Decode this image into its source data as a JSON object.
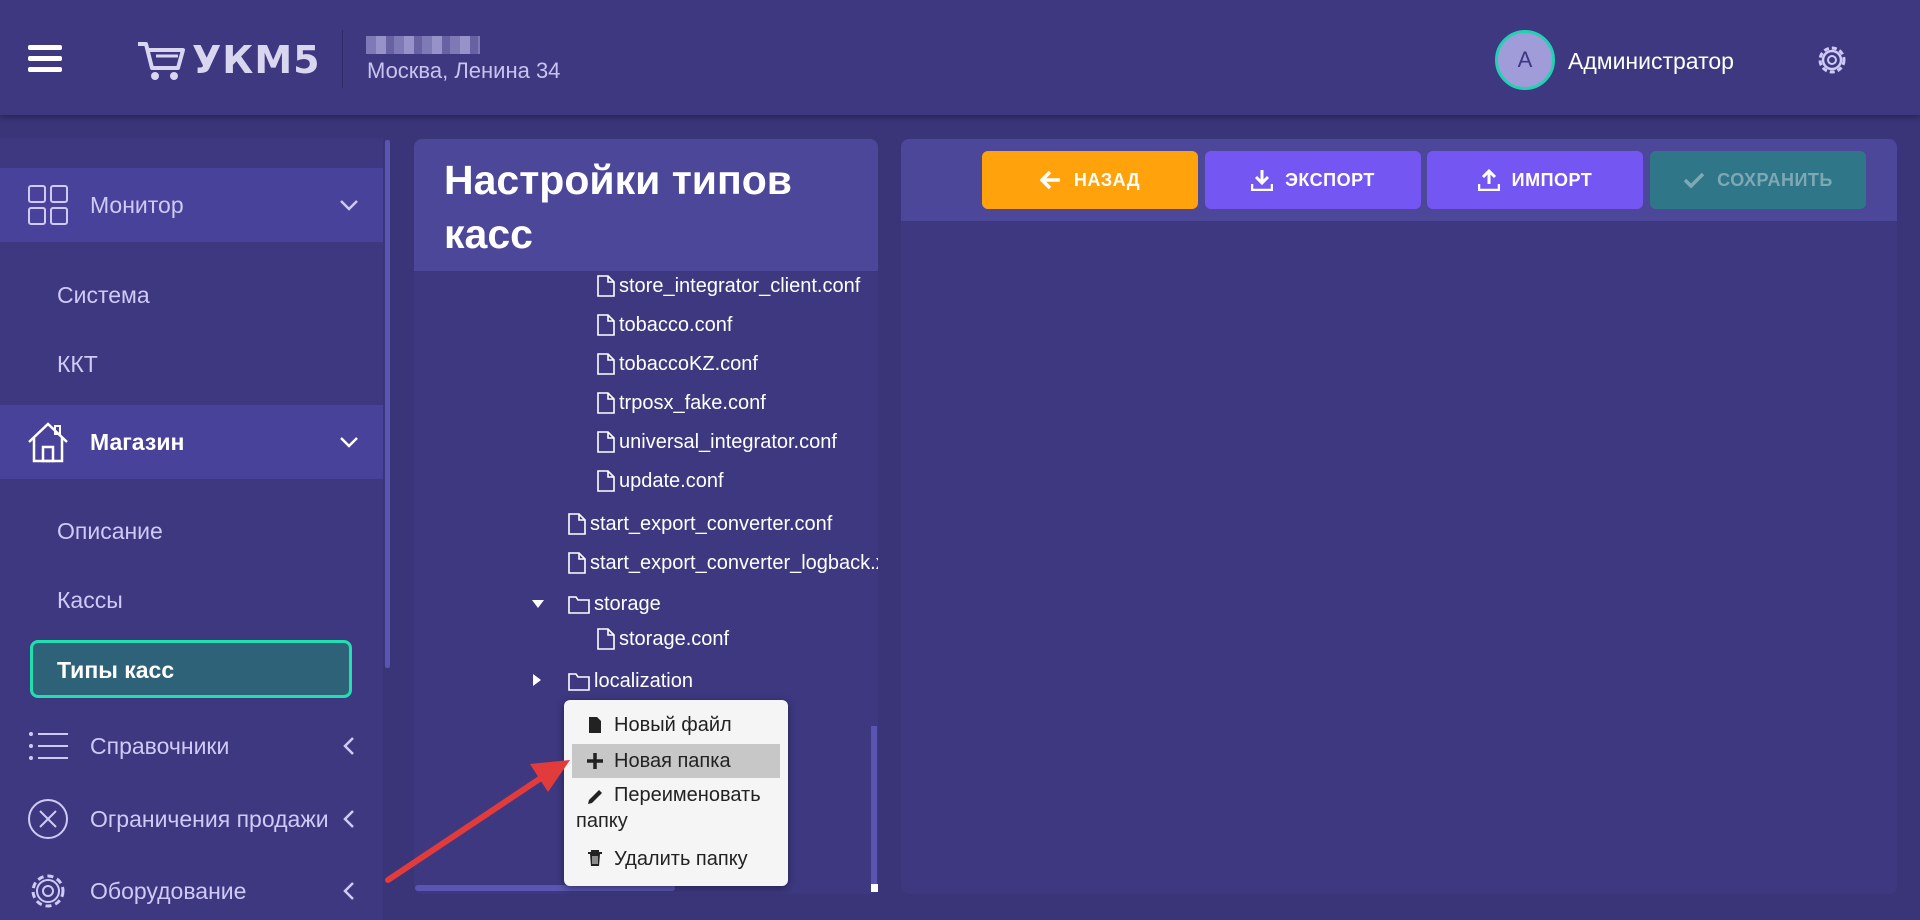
{
  "header": {
    "logo_text": "УКМ5",
    "store_address": "Москва, Ленина 34",
    "avatar_letter": "А",
    "user_name": "Администратор"
  },
  "sidebar": {
    "groups": [
      {
        "label": "Монитор",
        "icon": "grid-icon"
      },
      {
        "label": "Магазин",
        "icon": "home-icon"
      },
      {
        "label": "Справочники",
        "icon": "list-icon"
      },
      {
        "label": "Ограничения продажи",
        "icon": "x-circle-icon"
      },
      {
        "label": "Оборудование",
        "icon": "gear-icon"
      }
    ],
    "monitor_items": [
      "Система",
      "ККТ"
    ],
    "store_items": [
      "Описание",
      "Кассы"
    ],
    "active_item": "Типы касс"
  },
  "panel": {
    "title": "Настройки типов касс"
  },
  "tree": {
    "files_level2": [
      "store_integrator_client.conf",
      "tobacco.conf",
      "tobaccoKZ.conf",
      "trposx_fake.conf",
      "universal_integrator.conf",
      "update.conf"
    ],
    "files_level1": [
      "start_export_converter.conf",
      "start_export_converter_logback.xml"
    ],
    "folder_storage": "storage",
    "storage_file": "storage.conf",
    "folder_localization": "localization"
  },
  "toolbar": {
    "back": "НАЗАД",
    "export": "ЭКСПОРТ",
    "import": "ИМПОРТ",
    "save": "СОХРАНИТЬ"
  },
  "context_menu": {
    "new_file": "Новый файл",
    "new_folder": "Новая папка",
    "rename_line1": "Переименовать",
    "rename_line2": "папку",
    "delete_folder": "Удалить папку"
  },
  "colors": {
    "accent_teal": "#20e0b0",
    "back_orange": "#ffa20b",
    "purple_button": "#7457f2",
    "save_disabled": "#2f7788",
    "annotation_arrow": "#e23b3b"
  }
}
